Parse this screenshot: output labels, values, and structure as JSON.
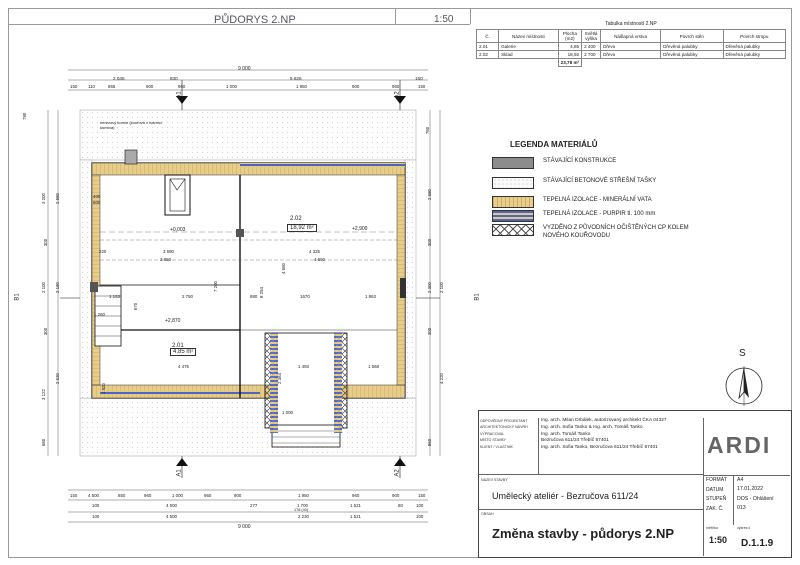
{
  "header": {
    "title": "PŮDORYS 2.NP",
    "scale": "1:50"
  },
  "rooms_table": {
    "title": "Tabulka místností 2.NP",
    "columns": [
      "Č.",
      "Název místnosti",
      "Plocha (m2)",
      "Světlá výška",
      "Nášlapná vrstva",
      "Povrch stěn",
      "Povrch stropu"
    ],
    "rows": [
      [
        "2.01",
        "Galerie",
        "4,85",
        "2 400",
        "Dřevo",
        "Dřevěná palubky",
        "Dřevěná palubky"
      ],
      [
        "2.02",
        "Sklad",
        "18,92",
        "2 700",
        "Dřevo",
        "Dřevěná palubky",
        "Dřevěná palubky"
      ]
    ],
    "total": "23,78 m²"
  },
  "legend": {
    "title": "LEGENDA MATERIÁLŮ",
    "items": [
      {
        "swatch": "grey",
        "label": "STÁVAJÍCÍ KONSTRUKCE"
      },
      {
        "swatch": "dots",
        "label": "STÁVAJÍCÍ BETONOVÉ STŘEŠNÍ TAŠKY"
      },
      {
        "swatch": "wool",
        "label": "TEPELNÁ IZOLACE - MINERÁLNÍ VATA"
      },
      {
        "swatch": "pir",
        "label": "TEPELNÁ IZOLACE - PURPIR tl. 100 mm"
      },
      {
        "swatch": "cross",
        "label": "VYZDĚNO Z PŮVODNÍCH OČIŠTĚNÝCH CP KOLEM NOVÉHO KOUŘOVODU"
      }
    ]
  },
  "compass": {
    "label": "S"
  },
  "drawing": {
    "dims_top_total": "9 000",
    "dims_top_mid": [
      "2 045",
      "830",
      "5 626",
      "150"
    ],
    "dims_top_detail": [
      "150",
      "110",
      "865",
      "900",
      "960",
      "1 000",
      "1 950",
      "900",
      "960",
      "150"
    ],
    "dims_bottom_detail": [
      "150",
      "4 500",
      "850",
      "960",
      "1 000",
      "960",
      "900",
      "1 950",
      "960",
      "900",
      "150"
    ],
    "dims_bottom_mid": [
      "100",
      "4 500",
      "277",
      "1 700",
      "1 521",
      "80",
      "100"
    ],
    "dims_bottom_sub": "178 (40)",
    "dims_bottom_row3": [
      "100",
      "4 500",
      "2 230",
      "1 521",
      "100"
    ],
    "dims_bottom_total": "9 000",
    "dims_left": [
      "780",
      "3 200",
      "300",
      "2 100",
      "300",
      "3 122",
      "680"
    ],
    "dims_left_inner": [
      "2 580",
      "2 180",
      "2 630"
    ],
    "dims_right": [
      "780",
      "2 580",
      "300",
      "2 300",
      "2 100",
      "300",
      "4 220",
      "860"
    ],
    "section_marks": [
      "A1",
      "A2",
      "B1"
    ],
    "note_chimney": "nerezový komín (kouřová v tvárnici komína)",
    "room_201": {
      "number": "2.01",
      "area": "4,85 m²",
      "level": "+2,870"
    },
    "room_202": {
      "number": "2.02",
      "area": "18,92 m²",
      "level": "+2,900"
    },
    "level_left": "+0,003",
    "inner_dims": [
      "3 690",
      "3 850",
      "4 325",
      "4 650",
      "2 750",
      "880",
      "1670",
      "1 863",
      "4 475",
      "1 493",
      "1 568",
      "7 200",
      "4 660",
      "670",
      "1 920",
      "2 384",
      "8 254",
      "1 260",
      "220",
      "1 000"
    ],
    "small_labels": [
      "400",
      "600",
      "1 153"
    ]
  },
  "title_block": {
    "rows": [
      {
        "key": "ODPOVĚDNÝ PROJEKTANT",
        "value": "Ing. arch. Milan Drbálek, autorizovaný architekt ČKA 04327"
      },
      {
        "key": "ARCHITEKTONICKÝ NÁVRH",
        "value": "Ing. arch. Sofia Tanko & Ing. arch. Tomáš Tanko"
      },
      {
        "key": "VYPRACOVAL",
        "value": "Ing. arch. Tomáš Tanko"
      },
      {
        "key": "MÍSTO STAVBY",
        "value": "Bezručova 611/24 Třebíč 67401"
      },
      {
        "key": "KLIENT / VLASTNÍK",
        "value": "Ing. arch. Sofia Tanko, Bezručova 611/24 Třebíč 67401"
      }
    ],
    "logo": "ARDI",
    "project_key": "NÁZEV STAVBY",
    "project_name": "Umělecký ateliér - Bezručova 611/24",
    "content_key": "OBSAH",
    "content_name": "Změna stavby - půdorys 2.NP",
    "scale_key": "měřítko",
    "scale": "1:50",
    "meta": [
      {
        "key": "FORMÁT",
        "value": "A4"
      },
      {
        "key": "DATUM",
        "value": "17.01.2022"
      },
      {
        "key": "STUPEŇ",
        "value": "DOS - Ohlášení"
      },
      {
        "key": "ZAK. Č.",
        "value": "013"
      }
    ],
    "sheet_key": "výkres č.",
    "sheet": "D.1.1.9"
  }
}
